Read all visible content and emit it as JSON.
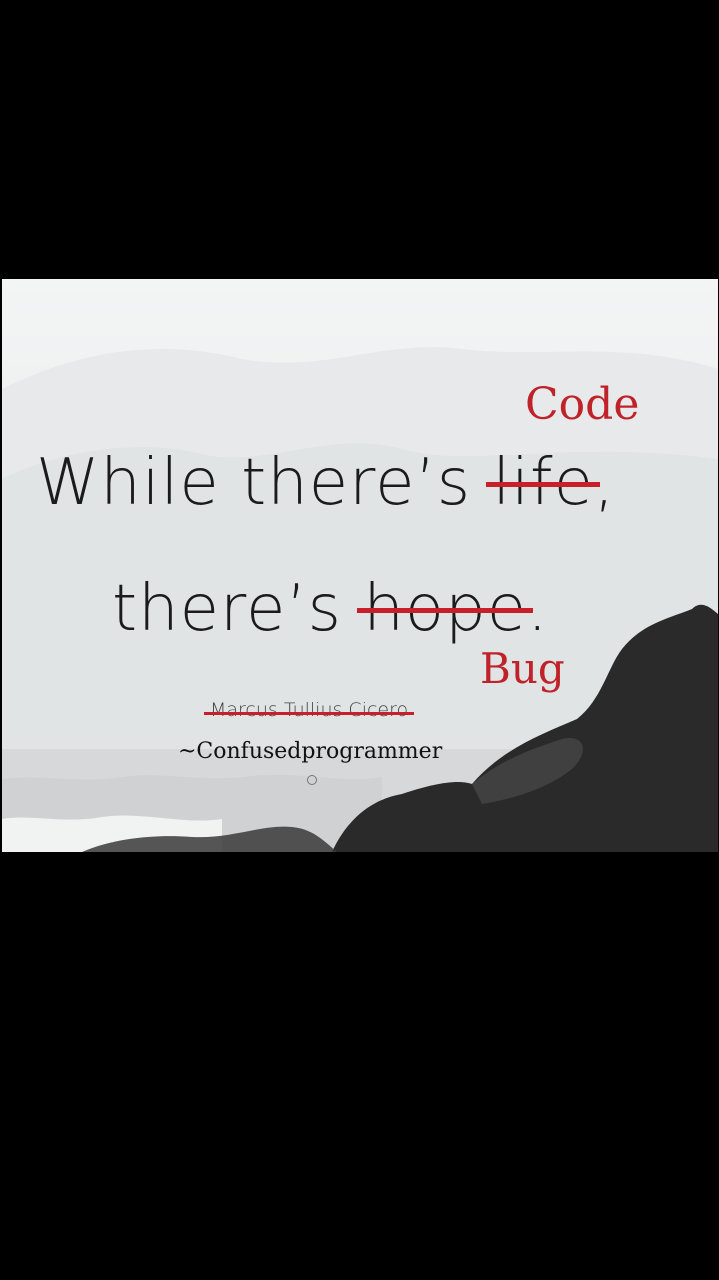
{
  "meme": {
    "line1_prefix": "While there’s ",
    "line1_struck": "life",
    "line1_suffix": ",",
    "line2_prefix": "there’s ",
    "line2_struck": "hope",
    "line2_suffix": ".",
    "correction_top": "Code",
    "correction_bottom": "Bug",
    "original_author": "Marcus Tullius Cicero",
    "new_author": "~Confusedprogrammer"
  },
  "colors": {
    "background": "#000000",
    "correction_red": "#c0222a",
    "quote_text": "#1b1b1b"
  }
}
